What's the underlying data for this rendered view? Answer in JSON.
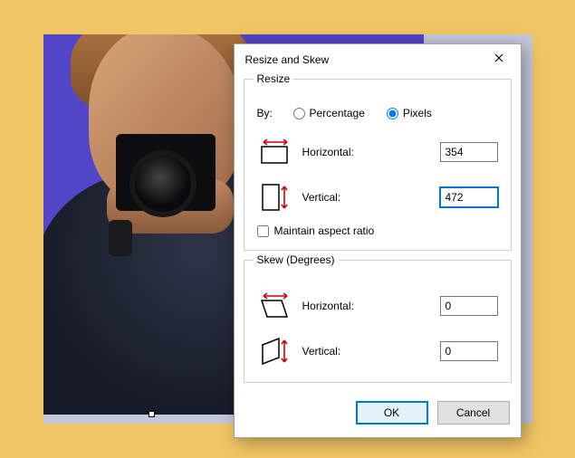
{
  "dialog": {
    "title": "Resize and Skew",
    "resize": {
      "group_label": "Resize",
      "by_label": "By:",
      "option_percentage": "Percentage",
      "option_pixels": "Pixels",
      "selected": "pixels",
      "horizontal_label": "Horizontal:",
      "horizontal_value": "354",
      "vertical_label": "Vertical:",
      "vertical_value": "472",
      "maintain_label": "Maintain aspect ratio",
      "maintain_checked": false
    },
    "skew": {
      "group_label": "Skew (Degrees)",
      "horizontal_label": "Horizontal:",
      "horizontal_value": "0",
      "vertical_label": "Vertical:",
      "vertical_value": "0"
    },
    "buttons": {
      "ok": "OK",
      "cancel": "Cancel"
    }
  }
}
